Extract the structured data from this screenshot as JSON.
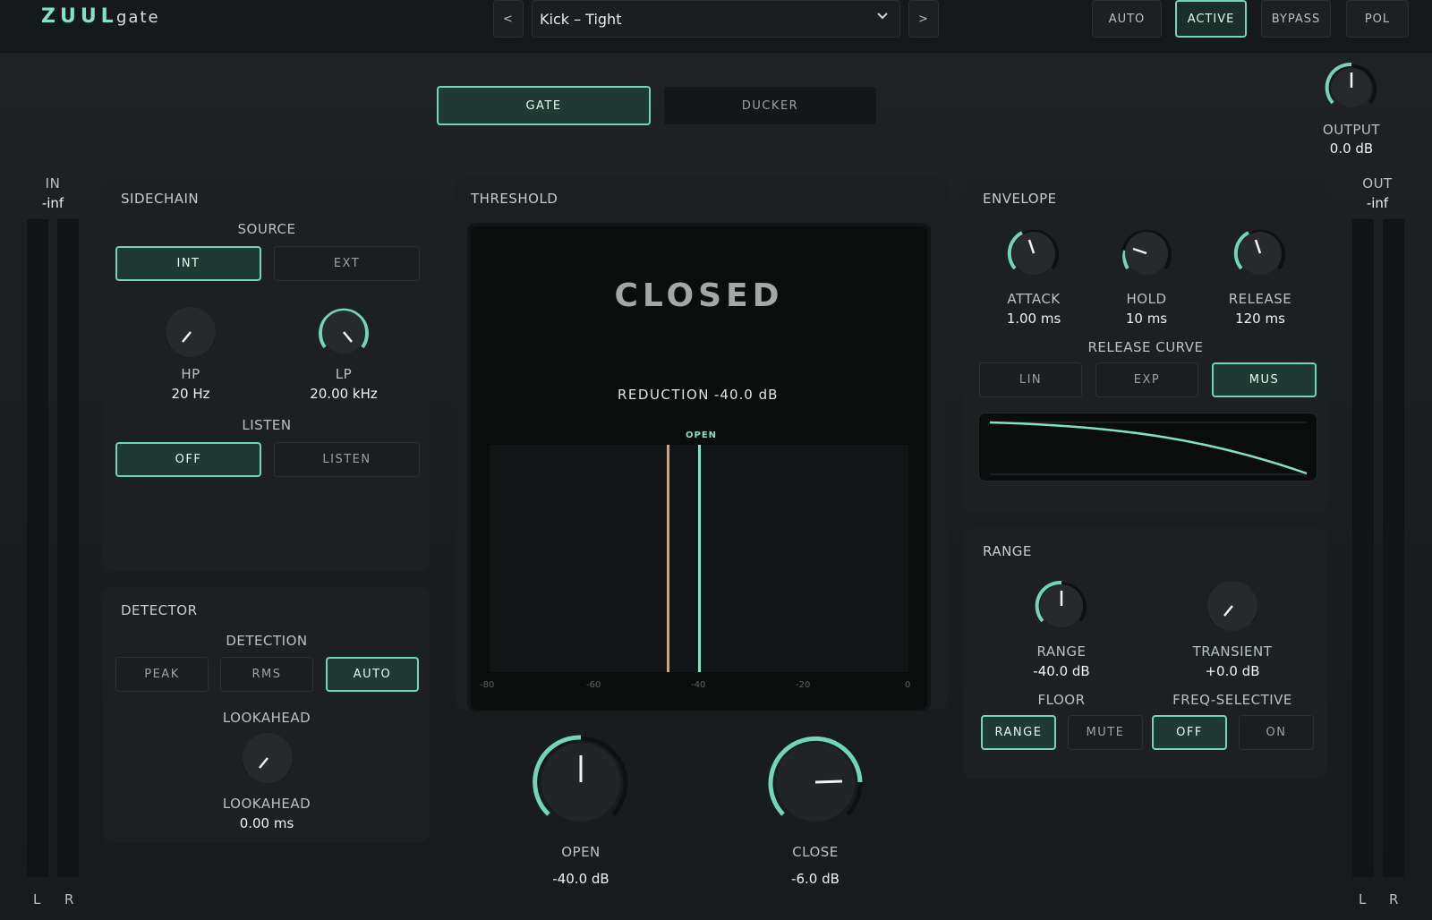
{
  "header": {
    "brand": "ZUUL",
    "product": "gate",
    "prev_label": "<",
    "next_label": ">",
    "preset_name": "Kick – Tight",
    "buttons": [
      "AUTO",
      "ACTIVE",
      "BYPASS",
      "POL"
    ],
    "active_button": "ACTIVE"
  },
  "mode": {
    "gate_label": "GATE",
    "ducker_label": "DUCKER",
    "selected": "GATE"
  },
  "output": {
    "label": "OUTPUT",
    "value": "0.0 dB"
  },
  "meters": {
    "in_label": "IN",
    "in_value": "-inf",
    "out_label": "OUT",
    "out_value": "-inf",
    "left_label": "L",
    "right_label": "R"
  },
  "sidechain": {
    "title": "SIDECHAIN",
    "source_label": "SOURCE",
    "source_int": "INT",
    "source_ext": "EXT",
    "source_selected": "INT",
    "hp_label": "HP",
    "hp_value": "20 Hz",
    "lp_label": "LP",
    "lp_value": "20.00 kHz",
    "listen_label": "LISTEN",
    "listen_off": "OFF",
    "listen_on": "LISTEN",
    "listen_selected": "OFF"
  },
  "detector": {
    "title": "DETECTOR",
    "detection_label": "DETECTION",
    "modes": [
      "PEAK",
      "RMS",
      "AUTO"
    ],
    "selected": "AUTO",
    "lookahead_header": "LOOKAHEAD",
    "lookahead_label": "LOOKAHEAD",
    "lookahead_value": "0.00 ms"
  },
  "threshold": {
    "title": "THRESHOLD",
    "state": "CLOSED",
    "reduction_label": "REDUCTION",
    "reduction_value": "-40.0 dB",
    "open_marker_label": "OPEN",
    "scale": [
      "-80",
      "-60",
      "-40",
      "-20",
      "0"
    ],
    "open_threshold_db": -40,
    "close_marker_db": -46,
    "open_label": "OPEN",
    "open_value": "-40.0 dB",
    "close_label": "CLOSE",
    "close_value": "-6.0 dB",
    "colors": {
      "open": "#7fe3c6",
      "close": "#e0a35c"
    }
  },
  "envelope": {
    "title": "ENVELOPE",
    "attack_label": "ATTACK",
    "attack_value": "1.00 ms",
    "hold_label": "HOLD",
    "hold_value": "10 ms",
    "release_label": "RELEASE",
    "release_value": "120 ms",
    "curve_label": "RELEASE CURVE",
    "curves": [
      "LIN",
      "EXP",
      "MUS"
    ],
    "curve_selected": "MUS"
  },
  "range": {
    "title": "RANGE",
    "range_label": "RANGE",
    "range_value": "-40.0 dB",
    "transient_label": "TRANSIENT",
    "transient_value": "+0.0 dB",
    "floor_label": "FLOOR",
    "floor_options": [
      "RANGE",
      "MUTE"
    ],
    "floor_selected": "RANGE",
    "freq_label": "FREQ-SELECTIVE",
    "freq_options": [
      "OFF",
      "ON"
    ],
    "freq_selected": "OFF"
  },
  "colors": {
    "accent": "#6fd6b8",
    "background": "#1a1d1f",
    "panel": "#1c2022"
  }
}
